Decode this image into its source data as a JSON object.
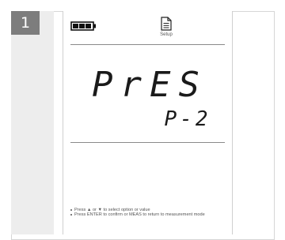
{
  "step": {
    "number": "1"
  },
  "display": {
    "setup_label": "Setup",
    "main_readout": "PrES",
    "sub_readout": "P-2",
    "battery_level": 1.0
  },
  "instructions": [
    "Press ▲ or ▼ to select option or value",
    "Press ENTER to confirm or MEAS to return to measurement mode"
  ],
  "icons": {
    "battery": "battery-full-icon",
    "setup": "setup-document-icon"
  },
  "colors": {
    "badge": "#7d7d7d",
    "sidebar": "#ededed",
    "lcd_text": "#1a1a1a"
  }
}
